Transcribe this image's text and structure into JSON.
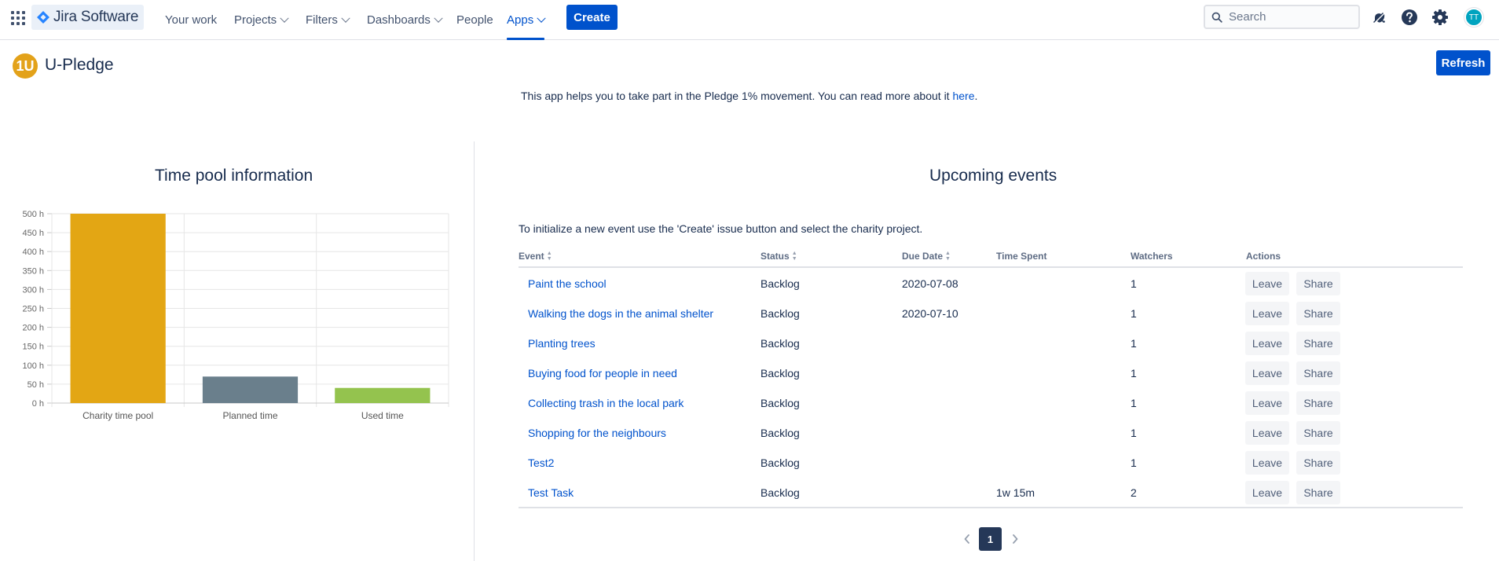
{
  "nav": {
    "product": "Jira Software",
    "items": [
      {
        "label": "Your work"
      },
      {
        "label": "Projects"
      },
      {
        "label": "Filters"
      },
      {
        "label": "Dashboards"
      },
      {
        "label": "People"
      },
      {
        "label": "Apps"
      }
    ],
    "create_label": "Create",
    "search_placeholder": "Search",
    "avatar_initials": "TT",
    "active_tab": "Apps",
    "accent_color": "#0052cc"
  },
  "app": {
    "logo_text": "1U",
    "title": "U-Pledge",
    "refresh_label": "Refresh",
    "intro_text": "This app helps you to take part in the Pledge 1% movement. You can read more about it ",
    "intro_link": "here",
    "intro_end": "."
  },
  "timepool": {
    "title": "Time pool information"
  },
  "chart_data": {
    "type": "bar",
    "title": "Time pool information",
    "categories": [
      "Charity time pool",
      "Planned time",
      "Used time"
    ],
    "values": [
      500,
      70,
      40
    ],
    "colors": [
      "#e3a614",
      "#6a7f8c",
      "#94c34e"
    ],
    "yticks": [
      "0 h",
      "50 h",
      "100 h",
      "150 h",
      "200 h",
      "250 h",
      "300 h",
      "350 h",
      "400 h",
      "450 h",
      "500 h"
    ],
    "ylim": [
      0,
      500
    ],
    "unit": "h",
    "grid": true,
    "legend": "none"
  },
  "events": {
    "title": "Upcoming events",
    "intro": "To initialize a new event use the 'Create' issue button and select the charity project.",
    "columns": {
      "event": "Event",
      "status": "Status",
      "due": "Due Date",
      "time": "Time Spent",
      "watchers": "Watchers",
      "actions": "Actions"
    },
    "rows": [
      {
        "event": "Paint the school",
        "status": "Backlog",
        "due": "2020-07-08",
        "time": "",
        "watchers": "1",
        "leave": "Leave",
        "share": "Share"
      },
      {
        "event": "Walking the dogs in the animal shelter",
        "status": "Backlog",
        "due": "2020-07-10",
        "time": "",
        "watchers": "1",
        "leave": "Leave",
        "share": "Share"
      },
      {
        "event": "Planting trees",
        "status": "Backlog",
        "due": "",
        "time": "",
        "watchers": "1",
        "leave": "Leave",
        "share": "Share"
      },
      {
        "event": "Buying food for people in need",
        "status": "Backlog",
        "due": "",
        "time": "",
        "watchers": "1",
        "leave": "Leave",
        "share": "Share"
      },
      {
        "event": "Collecting trash in the local park",
        "status": "Backlog",
        "due": "",
        "time": "",
        "watchers": "1",
        "leave": "Leave",
        "share": "Share"
      },
      {
        "event": "Shopping for the neighbours",
        "status": "Backlog",
        "due": "",
        "time": "",
        "watchers": "1",
        "leave": "Leave",
        "share": "Share"
      },
      {
        "event": "Test2",
        "status": "Backlog",
        "due": "",
        "time": "",
        "watchers": "1",
        "leave": "Leave",
        "share": "Share"
      },
      {
        "event": "Test Task",
        "status": "Backlog",
        "due": "",
        "time": "1w 15m",
        "watchers": "2",
        "leave": "Leave",
        "share": "Share"
      }
    ],
    "page": "1"
  }
}
